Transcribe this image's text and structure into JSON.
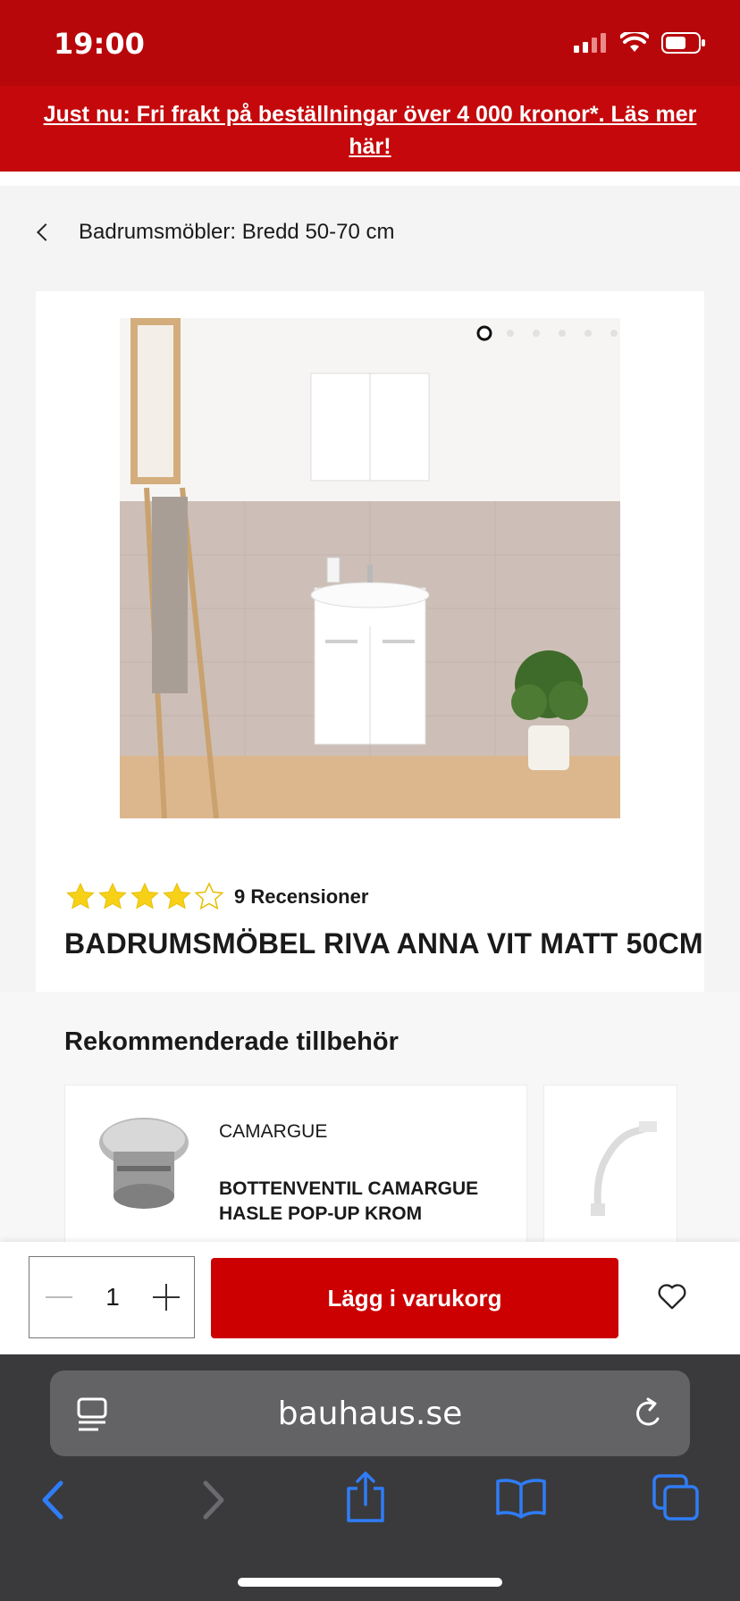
{
  "status": {
    "time": "19:00"
  },
  "banner": {
    "text": "Just nu: Fri frakt på beställningar över 4 000 kronor*. Läs mer här!"
  },
  "breadcrumb": {
    "label": "Badrumsmöbler: Bredd 50-70 cm"
  },
  "product": {
    "rating": 4,
    "rating_max": 5,
    "reviews": "9 Recensioner",
    "title": "BADRUMSMÖBEL RIVA ANNA VIT MATT 50CM",
    "carousel_count": 6,
    "carousel_active": 0
  },
  "recommended": {
    "heading": "Rekommenderade tillbehör",
    "items": [
      {
        "brand": "CAMARGUE",
        "name": "BOTTENVENTIL CAMARGUE HASLE POP-UP KROM",
        "icon": "drain-valve-image"
      },
      {
        "brand": "",
        "name": "",
        "icon": "drain-hose-image"
      }
    ]
  },
  "cart": {
    "quantity": "1",
    "add_label": "Lägg i varukorg"
  },
  "browser": {
    "url": "bauhaus.se"
  },
  "colors": {
    "brand_red": "#c4080b",
    "status_red": "#b8070a",
    "button_red": "#cc0000",
    "star": "#f7d117",
    "ios_blue": "#2f7cf6"
  }
}
